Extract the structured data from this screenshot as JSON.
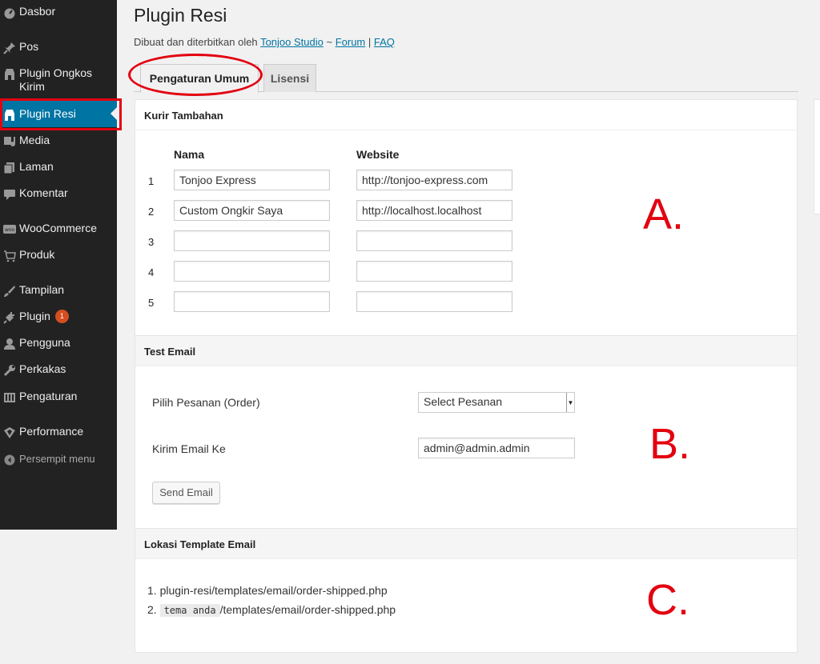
{
  "sidebar": {
    "items": [
      {
        "label": "Dasbor",
        "icon": "dashboard-icon"
      },
      {
        "label": "Pos",
        "icon": "pin-icon"
      },
      {
        "label": "Plugin Ongkos",
        "label2": "Kirim",
        "icon": "plugin-store-icon"
      },
      {
        "label": "Plugin Resi",
        "icon": "plugin-store-icon"
      },
      {
        "label": "Media",
        "icon": "media-icon"
      },
      {
        "label": "Laman",
        "icon": "page-icon"
      },
      {
        "label": "Komentar",
        "icon": "comment-icon"
      },
      {
        "label": "WooCommerce",
        "icon": "woocommerce-icon"
      },
      {
        "label": "Produk",
        "icon": "cart-icon"
      },
      {
        "label": "Tampilan",
        "icon": "brush-icon"
      },
      {
        "label": "Plugin",
        "badge": "1",
        "icon": "plug-icon"
      },
      {
        "label": "Pengguna",
        "icon": "user-icon"
      },
      {
        "label": "Perkakas",
        "icon": "wrench-icon"
      },
      {
        "label": "Pengaturan",
        "icon": "settings-icon"
      },
      {
        "label": "Performance",
        "icon": "performance-icon"
      }
    ],
    "collapse_label": "Persempit menu"
  },
  "header": {
    "title": "Plugin Resi",
    "subtitle_prefix": "Dibuat dan diterbitkan oleh",
    "author_link": "Tonjoo Studio",
    "separator1": "~",
    "forum_link": "Forum",
    "separator2": "|",
    "faq_link": "FAQ"
  },
  "tabs": {
    "general": "Pengaturan Umum",
    "license": "Lisensi"
  },
  "couriers": {
    "title": "Kurir Tambahan",
    "col_name": "Nama",
    "col_website": "Website",
    "rows": [
      {
        "num": "1",
        "name": "Tonjoo Express",
        "website": "http://tonjoo-express.com"
      },
      {
        "num": "2",
        "name": "Custom Ongkir Saya",
        "website": "http://localhost.localhost"
      },
      {
        "num": "3",
        "name": "",
        "website": ""
      },
      {
        "num": "4",
        "name": "",
        "website": ""
      },
      {
        "num": "5",
        "name": "",
        "website": ""
      }
    ],
    "annotation": "A."
  },
  "test_email": {
    "title": "Test Email",
    "order_label": "Pilih Pesanan (Order)",
    "order_select": "Select Pesanan",
    "email_label": "Kirim Email Ke",
    "email_value": "admin@admin.admin",
    "send_button": "Send Email",
    "annotation": "B."
  },
  "template": {
    "title": "Lokasi Template Email",
    "line1": "1. plugin-resi/templates/email/order-shipped.php",
    "line2_prefix": "2.",
    "line2_code": "tema anda",
    "line2_suffix": "/templates/email/order-shipped.php",
    "annotation": "C."
  },
  "colors": {
    "sidebar_bg": "#222222",
    "active_bg": "#0074a2",
    "annotation_red": "#e3000f",
    "link": "#0074a2",
    "badge": "#d54e21"
  }
}
